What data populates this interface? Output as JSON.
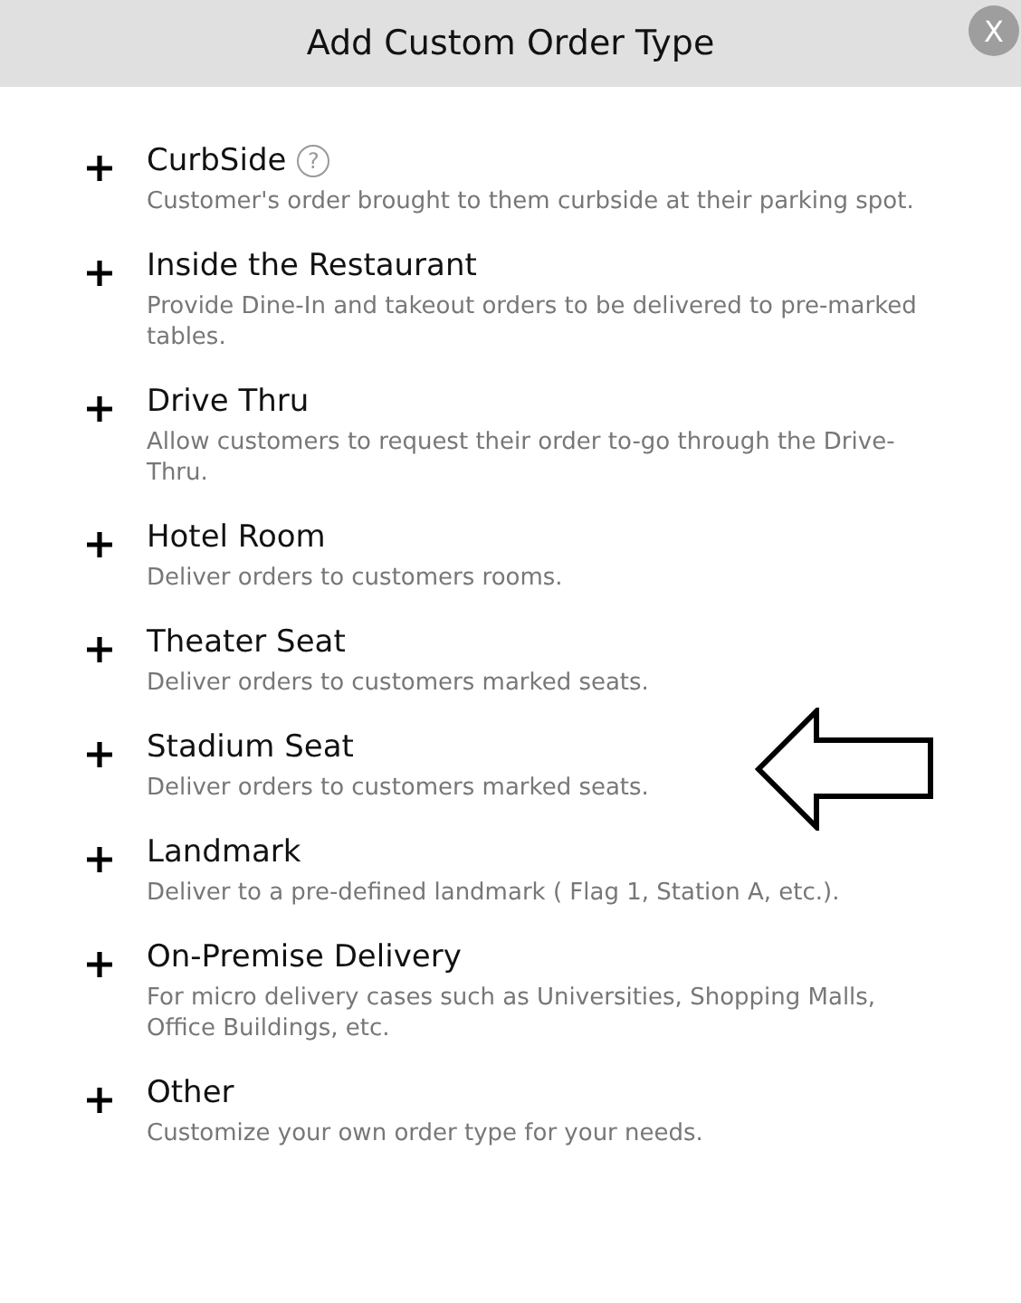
{
  "dialog": {
    "title": "Add Custom Order Type",
    "close": "X"
  },
  "order_types": [
    {
      "title": "CurbSide",
      "help": "?",
      "description": "Customer's order brought to them curbside at their parking spot."
    },
    {
      "title": "Inside the Restaurant",
      "description": "Provide Dine-In and takeout orders to be delivered to pre-marked tables."
    },
    {
      "title": "Drive Thru",
      "description": "Allow customers to request their order to-go through the Drive-Thru."
    },
    {
      "title": "Hotel Room",
      "description": "Deliver orders to customers rooms."
    },
    {
      "title": "Theater Seat",
      "description": "Deliver orders to customers marked seats."
    },
    {
      "title": "Stadium Seat",
      "description": "Deliver orders to customers marked seats."
    },
    {
      "title": "Landmark",
      "description": "Deliver to a pre-defined landmark ( Flag 1, Station A, etc.)."
    },
    {
      "title": "On-Premise Delivery",
      "description": "For micro delivery cases such as Universities, Shopping Malls, Office Buildings, etc."
    },
    {
      "title": "Other",
      "description": "Customize your own order type for your needs."
    }
  ]
}
